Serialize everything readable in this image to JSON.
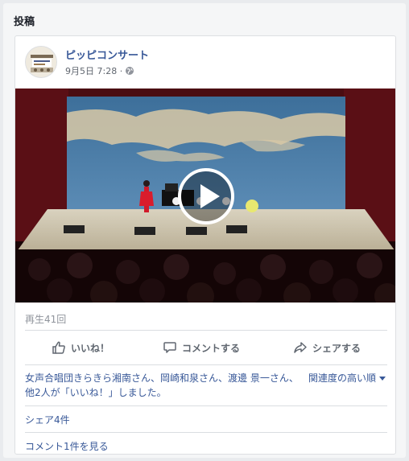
{
  "section": {
    "title": "投稿"
  },
  "post": {
    "author": "ピッピコンサート",
    "timestamp": "9月5日 7:28 · ",
    "privacy_icon": "globe-icon",
    "video": {
      "play_icon": "play-icon",
      "views": "再生41回"
    },
    "actions": {
      "like": {
        "label": "いいね！",
        "icon": "thumbs-up-icon"
      },
      "comment": {
        "label": "コメントする",
        "icon": "speech-bubble-icon"
      },
      "share": {
        "label": "シェアする",
        "icon": "share-arrow-icon"
      }
    },
    "likes_summary": "女声合唱団きらきら湘南さん、岡崎和泉さん、渡邊 景一さん、他2人が「いいね！」しました。",
    "sort_label": "関連度の高い順",
    "shares": "シェア4件",
    "view_comments": "コメント1件を見る"
  },
  "colors": {
    "link": "#385898",
    "muted": "#90949c",
    "action_text": "#606770",
    "card_border": "#dddfe2",
    "page_bg": "#e9ebee"
  }
}
